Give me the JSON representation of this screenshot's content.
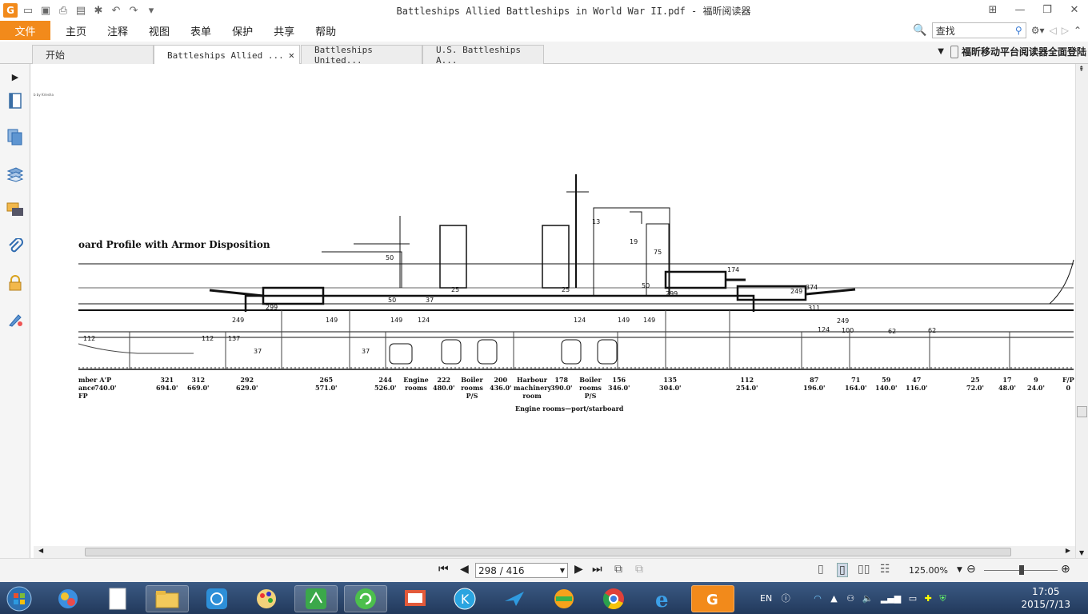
{
  "window": {
    "title": "Battleships Allied Battleships in World War II.pdf - 福昕阅读器"
  },
  "menu": {
    "file": "文件",
    "items": [
      "主页",
      "注释",
      "视图",
      "表单",
      "保护",
      "共享",
      "帮助"
    ],
    "search_placeholder": "查找"
  },
  "tabs": [
    {
      "label": "开始"
    },
    {
      "label": "Battleships Allied ..."
    },
    {
      "label": "Battleships United..."
    },
    {
      "label": "U.S. Battleships A..."
    }
  ],
  "promo": "福昕移动平台阅读器全面登陆",
  "figure": {
    "corner_note": "b by Kriesha",
    "title": "oard Profile with Armor Disposition",
    "frames": [
      {
        "num": "mber",
        "ft": ""
      },
      {
        "num": "A'P",
        "ft": "740.0'"
      },
      {
        "num": "321",
        "ft": "694.0'"
      },
      {
        "num": "312",
        "ft": "669.0'"
      },
      {
        "num": "292",
        "ft": "629.0'"
      },
      {
        "num": "265",
        "ft": "571.0'"
      },
      {
        "num": "244",
        "ft": "526.0'"
      },
      {
        "num": "Engine rooms",
        "ft": ""
      },
      {
        "num": "222",
        "ft": "480.0'"
      },
      {
        "num": "Boiler rooms P/S",
        "ft": ""
      },
      {
        "num": "200",
        "ft": "436.0'"
      },
      {
        "num": "Harbour machinery room",
        "ft": ""
      },
      {
        "num": "178",
        "ft": "390.0'"
      },
      {
        "num": "Boiler rooms P/S",
        "ft": ""
      },
      {
        "num": "156",
        "ft": "346.0'"
      },
      {
        "num": "135",
        "ft": "304.0'"
      },
      {
        "num": "112",
        "ft": "254.0'"
      },
      {
        "num": "87",
        "ft": "196.0'"
      },
      {
        "num": "71",
        "ft": "164.0'"
      },
      {
        "num": "59",
        "ft": "140.0'"
      },
      {
        "num": "47",
        "ft": "116.0'"
      },
      {
        "num": "25",
        "ft": "72.0'"
      },
      {
        "num": "17",
        "ft": "48.0'"
      },
      {
        "num": "9",
        "ft": "24.0'"
      },
      {
        "num": "F/P",
        "ft": "0"
      }
    ],
    "left_labels": [
      "ance",
      "FP"
    ],
    "caption": "Engine rooms—port/starboard",
    "armor": [
      "299",
      "249",
      "149",
      "50",
      "37",
      "25",
      "124",
      "112",
      "137",
      "174",
      "374",
      "311",
      "100",
      "62",
      "13",
      "19",
      "75"
    ]
  },
  "status": {
    "page": "298 / 416",
    "zoom": "125.00%"
  },
  "taskbar": {
    "lang": "EN",
    "time": "17:05",
    "date": "2015/7/13"
  }
}
